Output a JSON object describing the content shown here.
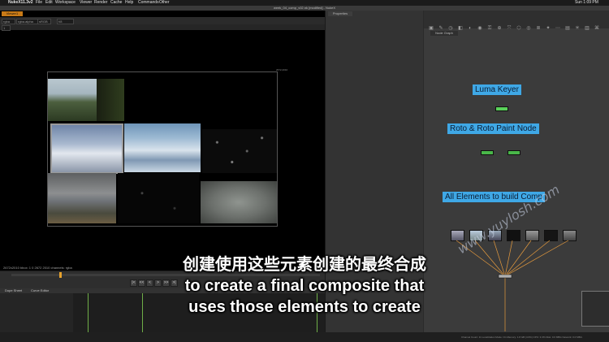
{
  "menubar": {
    "app": "NukeX11.3v2",
    "items": [
      "File",
      "Edit",
      "Workspace",
      "Viewer",
      "Render",
      "Cache",
      "Help",
      "Commands",
      "Other"
    ],
    "clock": "Sun 1:09 PM"
  },
  "window_title": "week_04_comp_v02.nk [modified] - NukeX",
  "viewer": {
    "tab_label": "Viewer1",
    "channels": "rgba",
    "layer": "rgba.alpha",
    "colorspace": "sRGB",
    "gain": "f/8",
    "frame": "1",
    "status": "2672x2010  bbox: 1 0 2672 2010  channels: rgba",
    "format_label": "2672,2010"
  },
  "timeline": {
    "transport": [
      "|<",
      "<<",
      "<",
      ">",
      ">>",
      ">|"
    ]
  },
  "dope_tabs": [
    "Dope Sheet",
    "Curve Editor"
  ],
  "properties": {
    "tab_label": "Properties"
  },
  "nodegraph": {
    "tab_label": "Node Graph"
  },
  "backdrops": {
    "luma": "Luma Keyer",
    "roto": "Roto & Roto Paint Node",
    "elements": "All Elements to build Comp"
  },
  "bottom_status": "Channel Count: 11  Localization Mode: On  Memory: 1.8 GB (4.6%)  CPU: 3.3%  Disk: 0.0 MB/s  Network: 0.0 MB/s",
  "subtitles": {
    "cn": "创建使用这些元素创建的最终合成",
    "en1": "to create a final composite that",
    "en2": "uses those elements to create"
  },
  "watermark": "www.yuylosh.com",
  "colors": {
    "backdrop": "#3fa8e6",
    "viewer_tab": "#c87a17",
    "wire": "#e59a3d",
    "keyframe_line": "#6fae48"
  }
}
